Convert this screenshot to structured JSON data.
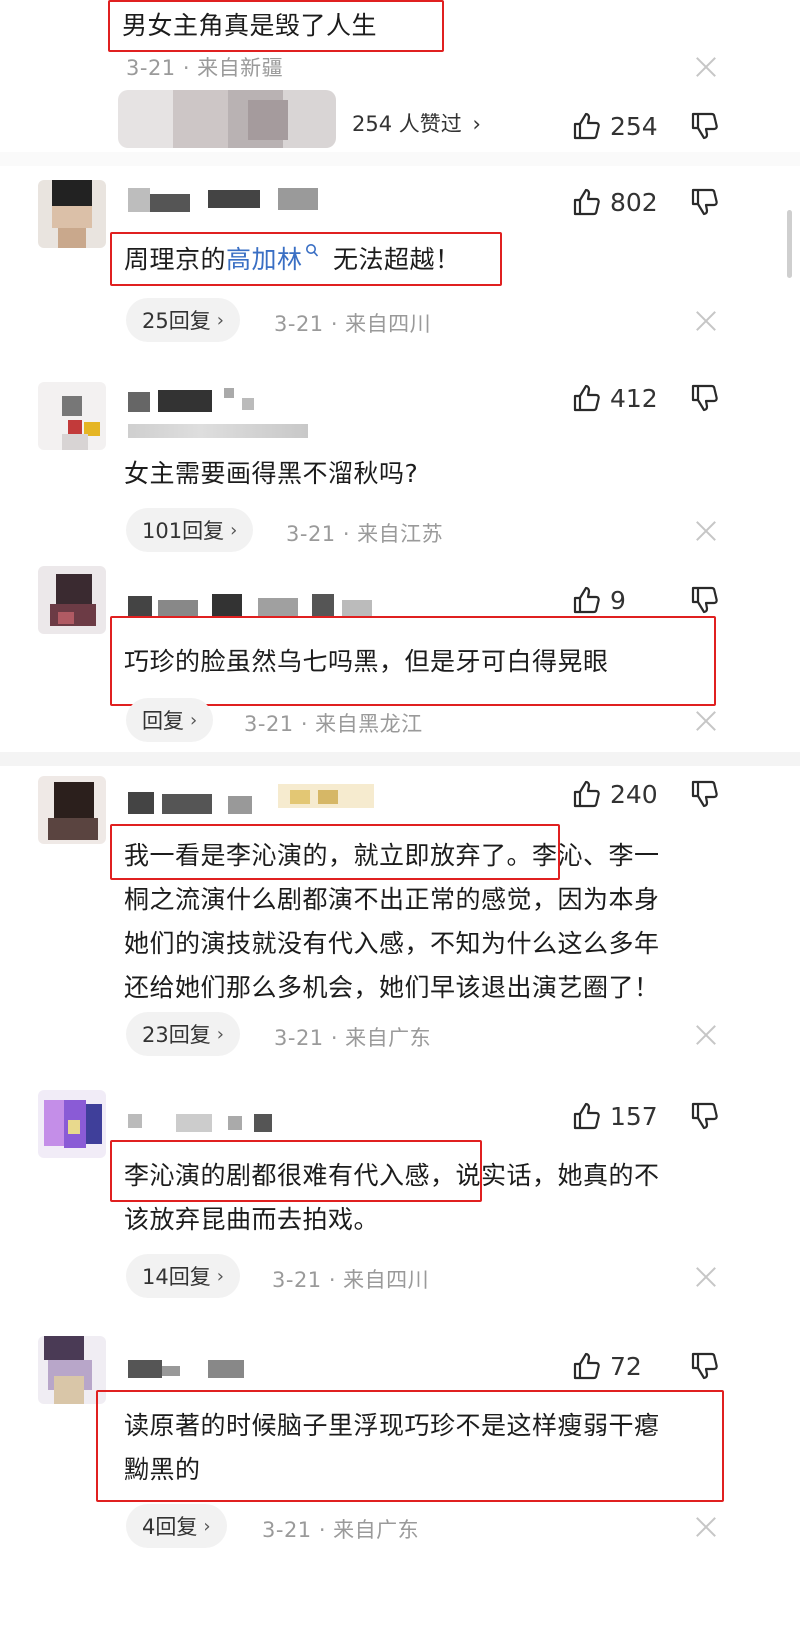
{
  "comments": [
    {
      "text": "男女主角真是毁了人生",
      "meta": "3-21 · 来自新疆",
      "liked_summary": "254 人赞过",
      "likes": "254"
    },
    {
      "text_prefix": "周理京的",
      "text_link": "高加林",
      "text_suffix": "无法超越！",
      "likes": "802",
      "reply": "25回复",
      "meta": "3-21 · 来自四川"
    },
    {
      "text": "女主需要画得黑不溜秋吗?",
      "likes": "412",
      "reply": "101回复",
      "meta": "3-21 · 来自江苏"
    },
    {
      "text": "巧珍的脸虽然乌七吗黑，但是牙可白得晃眼",
      "likes": "9",
      "reply": "回复",
      "meta": "3-21 · 来自黑龙江"
    },
    {
      "lines": [
        "我一看是李沁演的，就立即放弃了。李沁、李一",
        "桐之流演什么剧都演不出正常的感觉，因为本身",
        "她们的演技就没有代入感，不知为什么这么多年",
        "还给她们那么多机会，她们早该退出演艺圈了！"
      ],
      "likes": "240",
      "reply": "23回复",
      "meta": "3-21 · 来自广东"
    },
    {
      "lines": [
        "李沁演的剧都很难有代入感，说实话，她真的不",
        "该放弃昆曲而去拍戏。"
      ],
      "likes": "157",
      "reply": "14回复",
      "meta": "3-21 · 来自四川"
    },
    {
      "lines": [
        "读原著的时候脑子里浮现巧珍不是这样瘦弱干瘪",
        "黝黑的"
      ],
      "likes": "72",
      "reply": "4回复",
      "meta": "3-21 · 来自广东"
    }
  ],
  "icons": {
    "like": "thumbs-up-icon",
    "dislike": "thumbs-down-icon",
    "close": "close-icon",
    "chevron": "chevron-right-icon",
    "search": "search-icon"
  },
  "colors": {
    "highlight_box": "#e02020",
    "link": "#3a6fc4",
    "meta_text": "#9a9a9a"
  },
  "glyphs": {
    "chevron": "›"
  }
}
